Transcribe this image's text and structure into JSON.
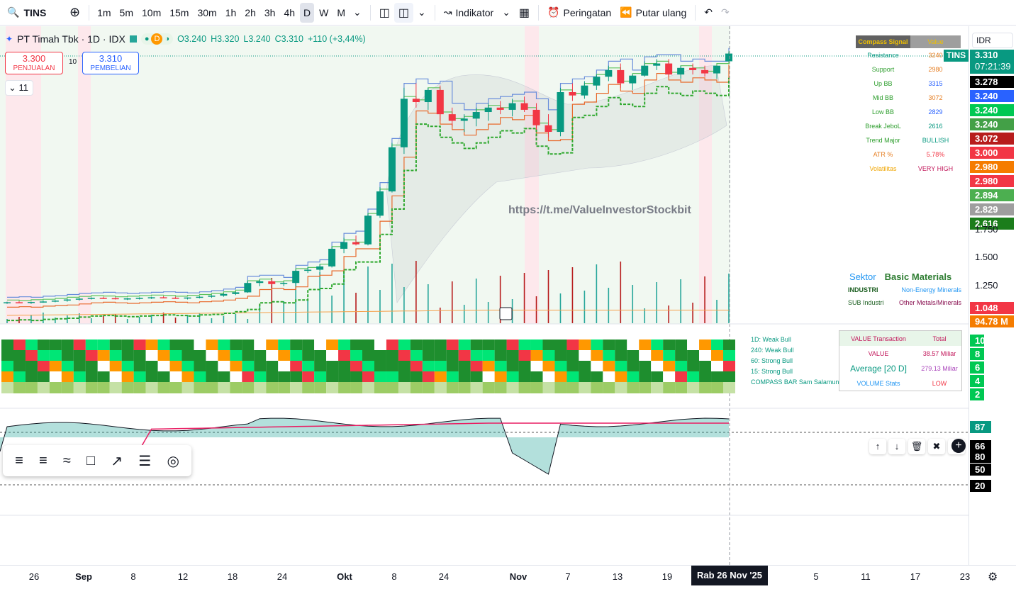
{
  "toolbar": {
    "symbol": "TINS",
    "intervals": [
      "1m",
      "5m",
      "10m",
      "15m",
      "30m",
      "1h",
      "2h",
      "3h",
      "4h",
      "D",
      "W",
      "M"
    ],
    "active_interval": "D",
    "indicators_label": "Indikator",
    "alerts_label": "Peringatan",
    "replay_label": "Putar ulang"
  },
  "legend": {
    "title": "PT Timah Tbk · 1D · IDX",
    "badge": "D",
    "open": "O3.240",
    "high": "H3.320",
    "low": "L3.240",
    "close": "C3.310",
    "change": "+110 (+3,44%)"
  },
  "trade": {
    "sell_price": "3.300",
    "sell_label": "PENJUALAN",
    "spread": "10",
    "buy_price": "3.310",
    "buy_label": "PEMBELIAN",
    "indicator_count": "11"
  },
  "compass": {
    "header_left": "Compass Signal",
    "header_right": "Value",
    "rows": [
      {
        "label": "Resistance",
        "value": "3240",
        "color": "#089981",
        "vcolor": "#e67e22"
      },
      {
        "label": "Support",
        "value": "2980",
        "color": "#2e9e2e",
        "vcolor": "#e67e22"
      },
      {
        "label": "Up BB",
        "value": "3315",
        "color": "#2e9e2e",
        "vcolor": "#2962ff"
      },
      {
        "label": "Mid BB",
        "value": "3072",
        "color": "#2e9e2e",
        "vcolor": "#e67e22"
      },
      {
        "label": "Low BB",
        "value": "2829",
        "color": "#2e9e2e",
        "vcolor": "#2962ff"
      },
      {
        "label": "Break JeboL",
        "value": "2616",
        "color": "#2e9e2e",
        "vcolor": "#089981"
      },
      {
        "label": "Trend Major",
        "value": "BULLISH",
        "color": "#2e9e2e",
        "vcolor": "#089981"
      },
      {
        "label": "ATR %",
        "value": "5.78%",
        "color": "#e67e22",
        "vcolor": "#f23645"
      },
      {
        "label": "Volatilitas",
        "value": "VERY HIGH",
        "color": "#f0a500",
        "vcolor": "#c2185b"
      }
    ]
  },
  "watermark": "https://t.me/ValueInvestorStockbit",
  "sector": {
    "label": "Sektor",
    "value": "Basic Materials",
    "industri_label": "INDUSTRI",
    "industri_value": "Non-Energy Minerals",
    "sub_label": "SUB Industri",
    "sub_value": "Other Metals/Minerals"
  },
  "compass_bar": {
    "labels": [
      "1D: Weak Bull",
      "240: Weak Bull",
      "60: Strong Bull",
      "15: Strong Bull",
      "COMPASS BAR Sam Salamun"
    ]
  },
  "value_table": {
    "h1": "VALUE Transaction",
    "h2": "Total",
    "r1l": "VALUE",
    "r1v": "38.57 Miliar",
    "r2l": "Average [20 D]",
    "r2v": "279.13 Miliar",
    "r3l": "VOLUME Stats",
    "r3v": "LOW"
  },
  "price_axis": {
    "currency": "IDR",
    "symbol_tag": "TINS",
    "last_price": "3.310",
    "countdown": "07:21:39",
    "ticks": [
      "1.750",
      "1.500",
      "1.250"
    ],
    "labels": [
      {
        "text": "3.278",
        "bg": "#000000"
      },
      {
        "text": "3.240",
        "bg": "#2962ff"
      },
      {
        "text": "3.240",
        "bg": "#00c853"
      },
      {
        "text": "3.240",
        "bg": "#43a047"
      },
      {
        "text": "3.072",
        "bg": "#b71c1c"
      },
      {
        "text": "3.000",
        "bg": "#f23645"
      },
      {
        "text": "2.980",
        "bg": "#f57c00"
      },
      {
        "text": "2.980",
        "bg": "#f23645"
      },
      {
        "text": "2.894",
        "bg": "#4caf50"
      },
      {
        "text": "2.829",
        "bg": "#9e9e9e"
      },
      {
        "text": "2.616",
        "bg": "#1b7d1b"
      }
    ],
    "low_labels": [
      {
        "text": "1.048",
        "bg": "#f23645"
      },
      {
        "text": "94.78 M",
        "bg": "#f57c00"
      }
    ],
    "bar_axis": [
      "10",
      "8",
      "6",
      "4",
      "2"
    ],
    "osc_axis": [
      {
        "text": "87",
        "bg": "#089981"
      },
      {
        "text": "66",
        "bg": "#000000"
      },
      {
        "text": "80",
        "bg": "#000000"
      },
      {
        "text": "50",
        "bg": "#000000"
      },
      {
        "text": "20",
        "bg": "#000000"
      }
    ]
  },
  "time_axis": {
    "ticks": [
      {
        "t": "26",
        "b": false
      },
      {
        "t": "Sep",
        "b": true
      },
      {
        "t": "8",
        "b": false
      },
      {
        "t": "12",
        "b": false
      },
      {
        "t": "18",
        "b": false
      },
      {
        "t": "24",
        "b": false
      },
      {
        "t": "Okt",
        "b": true
      },
      {
        "t": "8",
        "b": false
      },
      {
        "t": "24",
        "b": false
      },
      {
        "t": "Nov",
        "b": true
      },
      {
        "t": "7",
        "b": false
      },
      {
        "t": "13",
        "b": false
      },
      {
        "t": "19",
        "b": false
      },
      {
        "t": "5",
        "b": false
      },
      {
        "t": "11",
        "b": false
      },
      {
        "t": "17",
        "b": false
      },
      {
        "t": "23",
        "b": false
      }
    ],
    "cursor_date": "Rab 26 Nov '25"
  },
  "chart_data": {
    "type": "candlestick",
    "symbol": "TINS",
    "candles": [
      [
        1050,
        1060,
        1040,
        1055
      ],
      [
        1055,
        1065,
        1045,
        1050
      ],
      [
        1050,
        1060,
        1040,
        1058
      ],
      [
        1058,
        1070,
        1050,
        1062
      ],
      [
        1062,
        1075,
        1055,
        1070
      ],
      [
        1070,
        1085,
        1060,
        1080
      ],
      [
        1080,
        1095,
        1070,
        1088
      ],
      [
        1088,
        1100,
        1080,
        1095
      ],
      [
        1095,
        1105,
        1085,
        1092
      ],
      [
        1092,
        1100,
        1080,
        1085
      ],
      [
        1085,
        1095,
        1075,
        1090
      ],
      [
        1090,
        1100,
        1080,
        1095
      ],
      [
        1095,
        1105,
        1085,
        1100
      ],
      [
        1100,
        1110,
        1090,
        1096
      ],
      [
        1096,
        1105,
        1085,
        1090
      ],
      [
        1090,
        1100,
        1080,
        1098
      ],
      [
        1098,
        1110,
        1090,
        1105
      ],
      [
        1105,
        1120,
        1095,
        1115
      ],
      [
        1115,
        1135,
        1105,
        1130
      ],
      [
        1130,
        1150,
        1120,
        1145
      ],
      [
        1145,
        1250,
        1140,
        1230
      ],
      [
        1230,
        1260,
        1200,
        1245
      ],
      [
        1245,
        1260,
        1210,
        1220
      ],
      [
        1220,
        1240,
        1200,
        1230
      ],
      [
        1230,
        1350,
        1225,
        1340
      ],
      [
        1340,
        1380,
        1320,
        1350
      ],
      [
        1350,
        1400,
        1330,
        1380
      ],
      [
        1380,
        1560,
        1370,
        1540
      ],
      [
        1540,
        1640,
        1500,
        1600
      ],
      [
        1600,
        1660,
        1570,
        1580
      ],
      [
        1580,
        1860,
        1570,
        1840
      ],
      [
        1840,
        2100,
        1820,
        2060
      ],
      [
        2060,
        2500,
        2050,
        2460
      ],
      [
        2460,
        3000,
        2400,
        2900
      ],
      [
        2900,
        3040,
        2820,
        2870
      ],
      [
        2870,
        3000,
        2800,
        2980
      ],
      [
        2980,
        3020,
        2700,
        2760
      ],
      [
        2760,
        2820,
        2650,
        2700
      ],
      [
        2700,
        2760,
        2600,
        2720
      ],
      [
        2720,
        2820,
        2650,
        2780
      ],
      [
        2780,
        2860,
        2700,
        2820
      ],
      [
        2820,
        2880,
        2760,
        2800
      ],
      [
        2800,
        2900,
        2740,
        2860
      ],
      [
        2860,
        2920,
        2780,
        2800
      ],
      [
        2800,
        2860,
        2620,
        2660
      ],
      [
        2660,
        2760,
        2550,
        2600
      ],
      [
        2600,
        3000,
        2560,
        2960
      ],
      [
        2960,
        3040,
        2880,
        2930
      ],
      [
        2930,
        3060,
        2900,
        3020
      ],
      [
        3020,
        3120,
        2980,
        3100
      ],
      [
        3100,
        3200,
        3060,
        3160
      ],
      [
        3160,
        3220,
        3000,
        3040
      ],
      [
        3040,
        3120,
        2980,
        3110
      ],
      [
        3110,
        3240,
        3100,
        3200
      ],
      [
        3200,
        3260,
        3160,
        3220
      ],
      [
        3220,
        3260,
        3100,
        3120
      ],
      [
        3120,
        3200,
        3080,
        3180
      ],
      [
        3180,
        3220,
        3120,
        3160
      ],
      [
        3160,
        3200,
        3100,
        3130
      ],
      [
        3130,
        3160,
        3080,
        3200
      ],
      [
        3240,
        3320,
        3240,
        3310
      ]
    ],
    "ylabel": "IDR"
  }
}
